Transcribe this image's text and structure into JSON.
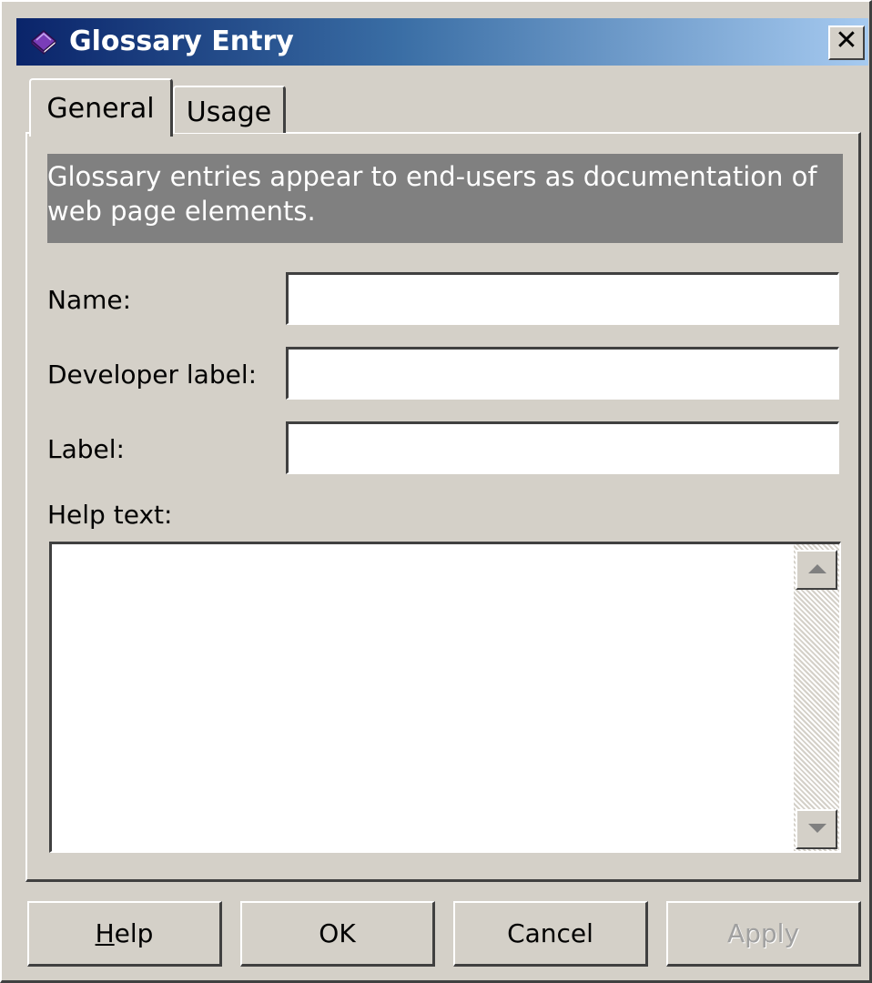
{
  "window": {
    "title": "Glossary Entry",
    "title_icon": "book-icon",
    "close_glyph": "✕",
    "titlebar_colors": [
      "#0a246a",
      "#a6caf0"
    ]
  },
  "tabs": [
    {
      "label": "General",
      "active": true
    },
    {
      "label": "Usage",
      "active": false
    }
  ],
  "general": {
    "info_text": "Glossary entries appear to end-users as documentation of web page elements.",
    "fields": {
      "name": {
        "label": "Name:",
        "value": ""
      },
      "developer_label": {
        "label": "Developer label:",
        "value": ""
      },
      "label": {
        "label": "Label:",
        "value": ""
      },
      "help_text": {
        "label": "Help text:",
        "value": ""
      }
    }
  },
  "buttons": {
    "help": "Help",
    "ok": "OK",
    "cancel": "Cancel",
    "apply": "Apply",
    "apply_disabled": true
  }
}
